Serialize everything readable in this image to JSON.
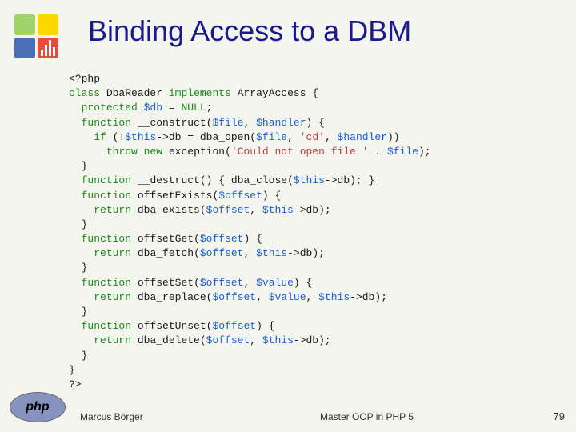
{
  "title": "Binding Access to a DBM",
  "code_raw": "<?php\nclass DbaReader implements ArrayAccess {\n  protected $db = NULL;\n  function __construct($file, $handler) {\n    if (!$this->db = dba_open($file, 'cd', $handler))\n      throw new exception('Could not open file ' . $file);\n  }\n  function __destruct() { dba_close($this->db); }\n  function offsetExists($offset) {\n    return dba_exists($offset, $this->db);\n  }\n  function offsetGet($offset) {\n    return dba_fetch($offset, $this->db);\n  }\n  function offsetSet($offset, $value) {\n    return dba_replace($offset, $value, $this->db);\n  }\n  function offsetUnset($offset) {\n    return dba_delete($offset, $this->db);\n  }\n}\n?>",
  "tokens": {
    "kw_class": "class",
    "kw_implements": "implements",
    "kw_protected": "protected",
    "kw_function": "function",
    "kw_if": "if",
    "kw_throw": "throw",
    "kw_new": "new",
    "kw_return": "return",
    "kw_null": "NULL",
    "var_db": "$db",
    "var_file": "$file",
    "var_handler": "$handler",
    "var_this": "$this",
    "var_offset": "$offset",
    "var_value": "$value",
    "str_cd": "'cd'",
    "str_err": "'Could not open file '",
    "id_DbaReader": "DbaReader",
    "id_ArrayAccess": "ArrayAccess",
    "fn_construct": "__construct",
    "fn_destruct": "__destruct",
    "fn_offsetExists": "offsetExists",
    "fn_offsetGet": "offsetGet",
    "fn_offsetSet": "offsetSet",
    "fn_offsetUnset": "offsetUnset",
    "fn_dba_open": "dba_open",
    "fn_dba_close": "dba_close",
    "fn_dba_exists": "dba_exists",
    "fn_dba_fetch": "dba_fetch",
    "fn_dba_replace": "dba_replace",
    "fn_dba_delete": "dba_delete",
    "fn_exception": "exception",
    "php_open": "<?php",
    "php_close": "?>"
  },
  "logo": {
    "php": "php"
  },
  "footer": {
    "left": "Marcus Börger",
    "center": "Master OOP in PHP 5",
    "page": "79"
  }
}
